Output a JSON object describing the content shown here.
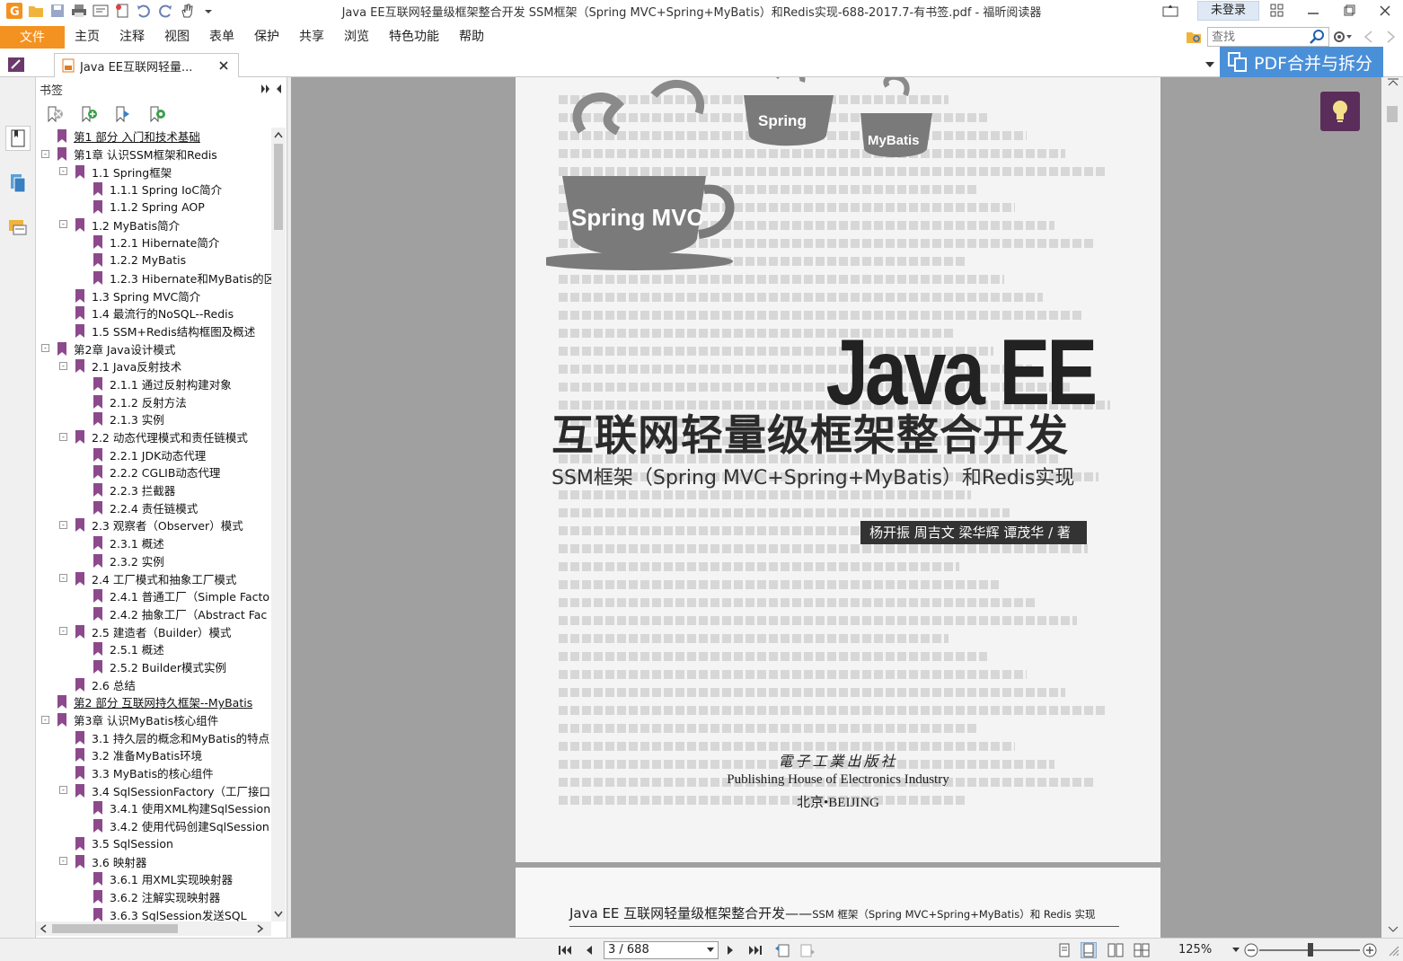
{
  "app": {
    "title": "Java EE互联网轻量级框架整合开发 SSM框架（Spring MVC+Spring+MyBatis）和Redis实现-688-2017.7-有书签.pdf - 福昕阅读器",
    "login_label": "未登录",
    "accent_color": "#f39221"
  },
  "menu": {
    "file": "文件",
    "items": [
      "主页",
      "注释",
      "视图",
      "表单",
      "保护",
      "共享",
      "浏览",
      "特色功能",
      "帮助"
    ]
  },
  "search": {
    "placeholder": "查找"
  },
  "tab": {
    "label": "Java EE互联网轻量..."
  },
  "promo": {
    "label": "PDF合并与拆分"
  },
  "bookmarks": {
    "header": "书签",
    "items": [
      {
        "label": "第1 部分  入门和技术基础",
        "level": 0,
        "toggle": ""
      },
      {
        "label": "第1章  认识SSM框架和Redis",
        "level": 0,
        "toggle": "-"
      },
      {
        "label": "1.1 Spring框架",
        "level": 1,
        "toggle": "-"
      },
      {
        "label": "1.1.1 Spring IoC简介",
        "level": 2,
        "toggle": ""
      },
      {
        "label": "1.1.2 Spring AOP",
        "level": 2,
        "toggle": ""
      },
      {
        "label": "1.2 MyBatis简介",
        "level": 1,
        "toggle": "-"
      },
      {
        "label": "1.2.1 Hibernate简介",
        "level": 2,
        "toggle": ""
      },
      {
        "label": "1.2.2 MyBatis",
        "level": 2,
        "toggle": ""
      },
      {
        "label": "1.2.3 Hibernate和MyBatis的区",
        "level": 2,
        "toggle": ""
      },
      {
        "label": "1.3 Spring MVC简介",
        "level": 1,
        "toggle": ""
      },
      {
        "label": "1.4 最流行的NoSQL--Redis",
        "level": 1,
        "toggle": ""
      },
      {
        "label": "1.5 SSM+Redis结构框图及概述",
        "level": 1,
        "toggle": ""
      },
      {
        "label": "第2章  Java设计模式",
        "level": 0,
        "toggle": "-"
      },
      {
        "label": "2.1 Java反射技术",
        "level": 1,
        "toggle": "-"
      },
      {
        "label": "2.1.1 通过反射构建对象",
        "level": 2,
        "toggle": ""
      },
      {
        "label": "2.1.2 反射方法",
        "level": 2,
        "toggle": ""
      },
      {
        "label": "2.1.3 实例",
        "level": 2,
        "toggle": ""
      },
      {
        "label": "2.2 动态代理模式和责任链模式",
        "level": 1,
        "toggle": "-"
      },
      {
        "label": "2.2.1 JDK动态代理",
        "level": 2,
        "toggle": ""
      },
      {
        "label": "2.2.2 CGLIB动态代理",
        "level": 2,
        "toggle": ""
      },
      {
        "label": "2.2.3 拦截器",
        "level": 2,
        "toggle": ""
      },
      {
        "label": "2.2.4 责任链模式",
        "level": 2,
        "toggle": ""
      },
      {
        "label": "2.3 观察者（Observer）模式",
        "level": 1,
        "toggle": "-"
      },
      {
        "label": "2.3.1 概述",
        "level": 2,
        "toggle": ""
      },
      {
        "label": "2.3.2 实例",
        "level": 2,
        "toggle": ""
      },
      {
        "label": "2.4 工厂模式和抽象工厂模式",
        "level": 1,
        "toggle": "-"
      },
      {
        "label": "2.4.1 普通工厂（Simple Facto",
        "level": 2,
        "toggle": ""
      },
      {
        "label": "2.4.2 抽象工厂（Abstract Fac",
        "level": 2,
        "toggle": ""
      },
      {
        "label": "2.5 建造者（Builder）模式",
        "level": 1,
        "toggle": "-"
      },
      {
        "label": "2.5.1 概述",
        "level": 2,
        "toggle": ""
      },
      {
        "label": "2.5.2 Builder模式实例",
        "level": 2,
        "toggle": ""
      },
      {
        "label": "2.6 总结",
        "level": 1,
        "toggle": ""
      },
      {
        "label": "第2 部分  互联网持久框架--MyBatis",
        "level": 0,
        "toggle": ""
      },
      {
        "label": "第3章  认识MyBatis核心组件",
        "level": 0,
        "toggle": "-"
      },
      {
        "label": "3.1 持久层的概念和MyBatis的特点",
        "level": 1,
        "toggle": ""
      },
      {
        "label": "3.2 准备MyBatis环境",
        "level": 1,
        "toggle": ""
      },
      {
        "label": "3.3 MyBatis的核心组件",
        "level": 1,
        "toggle": ""
      },
      {
        "label": "3.4 SqlSessionFactory（工厂接口",
        "level": 1,
        "toggle": "-"
      },
      {
        "label": "3.4.1 使用XML构建SqlSessionF",
        "level": 2,
        "toggle": ""
      },
      {
        "label": "3.4.2 使用代码创建SqlSession",
        "level": 2,
        "toggle": ""
      },
      {
        "label": "3.5 SqlSession",
        "level": 1,
        "toggle": ""
      },
      {
        "label": "3.6 映射器",
        "level": 1,
        "toggle": "-"
      },
      {
        "label": "3.6.1 用XML实现映射器",
        "level": 2,
        "toggle": ""
      },
      {
        "label": "3.6.2 注解实现映射器",
        "level": 2,
        "toggle": ""
      },
      {
        "label": "3.6.3 SqlSession发送SQL",
        "level": 2,
        "toggle": ""
      }
    ]
  },
  "cover": {
    "cup_labels": [
      "Spring",
      "MyBatis",
      "Spring MVC"
    ],
    "title": "Java EE",
    "subtitle": "互联网轻量级框架整合开发",
    "subtitle2": "SSM框架（Spring MVC+Spring+MyBatis）和Redis实现",
    "authors": "杨开振  周吉文  梁华辉  谭茂华 / 著",
    "publisher_cn": "電子工業出版社",
    "publisher_en": "Publishing House of Electronics Industry",
    "publisher_city": "北京•BEIJING"
  },
  "page2": {
    "header_main": "Java EE 互联网轻量级框架整合开发——",
    "header_small": "SSM 框架（Spring MVC+Spring+MyBatis）和 Redis 实现"
  },
  "status": {
    "page_indicator": "3 / 688",
    "zoom": "125%",
    "zoom_fraction": 0.51
  }
}
